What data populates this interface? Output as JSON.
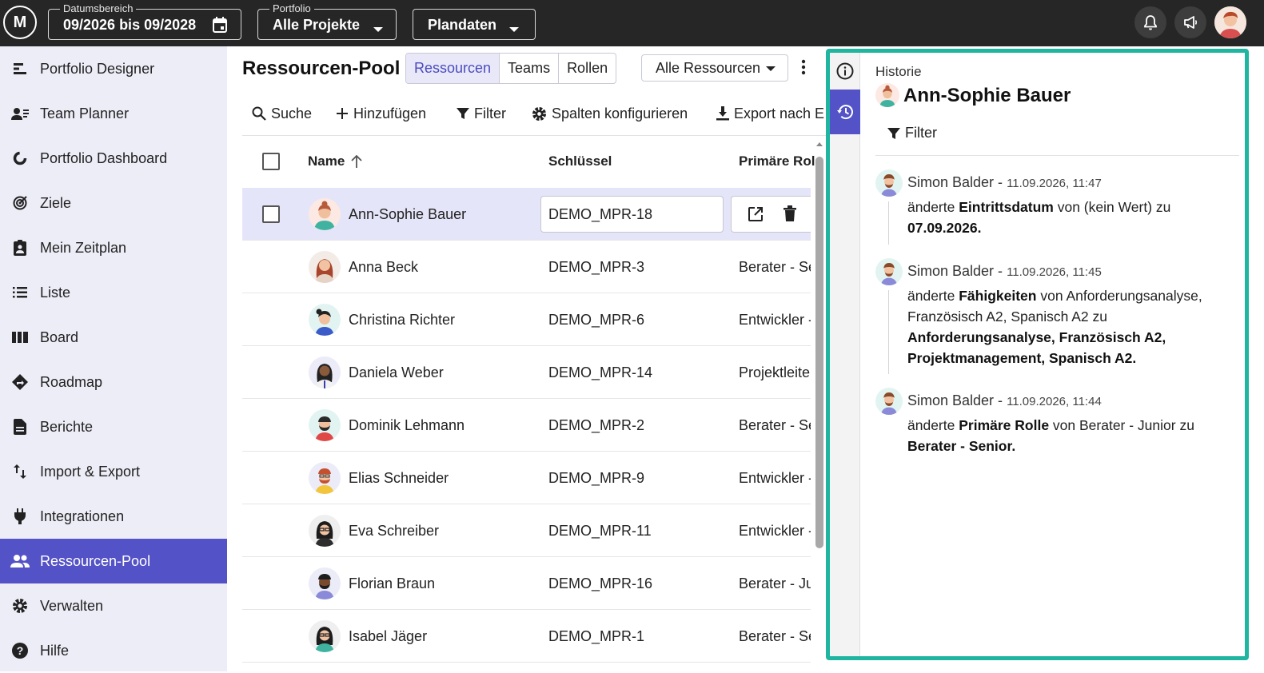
{
  "header": {
    "logo_text": "M",
    "date_range": {
      "legend": "Datumsbereich",
      "value": "09/2026 bis 09/2028"
    },
    "portfolio": {
      "legend": "Portfolio",
      "value": "Alle Projekte"
    },
    "plan": {
      "value": "Plandaten"
    }
  },
  "sidebar": {
    "items": [
      {
        "label": "Portfolio Designer",
        "icon": "portfolio-designer-icon"
      },
      {
        "label": "Team Planner",
        "icon": "team-planner-icon"
      },
      {
        "label": "Portfolio Dashboard",
        "icon": "dashboard-icon"
      },
      {
        "label": "Ziele",
        "icon": "target-icon"
      },
      {
        "label": "Mein Zeitplan",
        "icon": "schedule-icon"
      },
      {
        "label": "Liste",
        "icon": "list-icon"
      },
      {
        "label": "Board",
        "icon": "board-icon"
      },
      {
        "label": "Roadmap",
        "icon": "roadmap-icon"
      },
      {
        "label": "Berichte",
        "icon": "report-icon"
      },
      {
        "label": "Import & Export",
        "icon": "import-export-icon"
      },
      {
        "label": "Integrationen",
        "icon": "plug-icon"
      },
      {
        "label": "Ressourcen-Pool",
        "icon": "people-icon",
        "active": true
      },
      {
        "label": "Verwalten",
        "icon": "gear-icon"
      },
      {
        "label": "Hilfe",
        "icon": "help-icon"
      }
    ]
  },
  "main": {
    "title": "Ressourcen-Pool",
    "tabs": [
      "Ressourcen",
      "Teams",
      "Rollen"
    ],
    "active_tab": "Ressourcen",
    "filter_select": "Alle Ressourcen",
    "toolbar": {
      "search": "Suche",
      "add": "Hinzufügen",
      "filter": "Filter",
      "columns": "Spalten konfigurieren",
      "export": "Export nach E"
    },
    "columns": {
      "name": "Name",
      "key": "Schlüssel",
      "role": "Primäre Rol"
    },
    "rows": [
      {
        "name": "Ann-Sophie Bauer",
        "key": "DEMO_MPR-18",
        "role": "",
        "selected": true
      },
      {
        "name": "Anna Beck",
        "key": "DEMO_MPR-3",
        "role": "Berater - Se"
      },
      {
        "name": "Christina Richter",
        "key": "DEMO_MPR-6",
        "role": "Entwickler -"
      },
      {
        "name": "Daniela Weber",
        "key": "DEMO_MPR-14",
        "role": "Projektleite"
      },
      {
        "name": "Dominik Lehmann",
        "key": "DEMO_MPR-2",
        "role": "Berater - Se"
      },
      {
        "name": "Elias Schneider",
        "key": "DEMO_MPR-9",
        "role": "Entwickler -"
      },
      {
        "name": "Eva Schreiber",
        "key": "DEMO_MPR-11",
        "role": "Entwickler -"
      },
      {
        "name": "Florian Braun",
        "key": "DEMO_MPR-16",
        "role": "Berater - Ju"
      },
      {
        "name": "Isabel Jäger",
        "key": "DEMO_MPR-1",
        "role": "Berater - Se"
      }
    ]
  },
  "history": {
    "label": "Historie",
    "person": "Ann-Sophie Bauer",
    "filter": "Filter",
    "entries": [
      {
        "who": "Simon Balder - ",
        "when": "11.09.2026, 11:47",
        "pre": "änderte ",
        "field": "Eintrittsdatum",
        "mid": " von (kein Wert) zu ",
        "new": "07.09.2026."
      },
      {
        "who": "Simon Balder - ",
        "when": "11.09.2026, 11:45",
        "pre": "änderte ",
        "field": "Fähigkeiten",
        "mid": " von Anforderungsanalyse, Französisch A2, Spanisch A2 zu ",
        "new": "Anforderungsanalyse, Französisch A2, Projektmanagement, Spanisch A2."
      },
      {
        "who": "Simon Balder - ",
        "when": "11.09.2026, 11:44",
        "pre": "änderte ",
        "field": "Primäre Rolle",
        "mid": " von Berater - Junior zu ",
        "new": "Berater - Senior."
      }
    ]
  },
  "colors": {
    "accent": "#5352c6",
    "panel_border": "#1fb5a0",
    "topbar": "#262626",
    "sidebar_bg": "#ededf8"
  }
}
